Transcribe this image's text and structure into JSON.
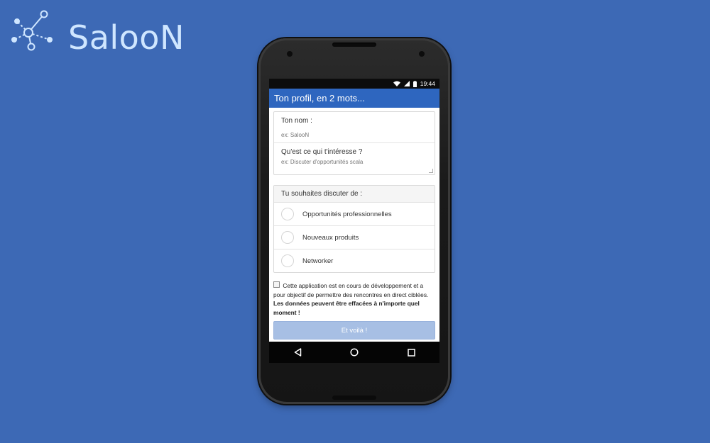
{
  "brand": {
    "name": "SalooN"
  },
  "status_bar": {
    "time": "19:44"
  },
  "app_bar": {
    "title": "Ton profil, en 2 mots..."
  },
  "form": {
    "name": {
      "label": "Ton nom :",
      "placeholder": "ex: SalooN"
    },
    "interest": {
      "label": "Qu'est ce qui t'intéresse ?",
      "placeholder": "ex: Discuter d'opportunités scala"
    }
  },
  "discussion": {
    "heading": "Tu souhaites discuter de :",
    "options": [
      {
        "label": "Opportunités professionnelles"
      },
      {
        "label": "Nouveaux produits"
      },
      {
        "label": "Networker"
      }
    ]
  },
  "disclaimer": {
    "text": "Cette application est en cours de développement et a pour objectif de permettre des rencontres en direct ciblées.",
    "bold": "Les données peuvent être effacées à n'importe quel moment !"
  },
  "submit": {
    "label": "Et voilà !"
  },
  "colors": {
    "background": "#3d69b5",
    "app_bar": "#2e66bf",
    "button": "#a7bfe4"
  },
  "icons": [
    "network-logo-icon",
    "wifi-icon",
    "signal-icon",
    "battery-icon",
    "back-icon",
    "home-icon",
    "recents-icon"
  ]
}
